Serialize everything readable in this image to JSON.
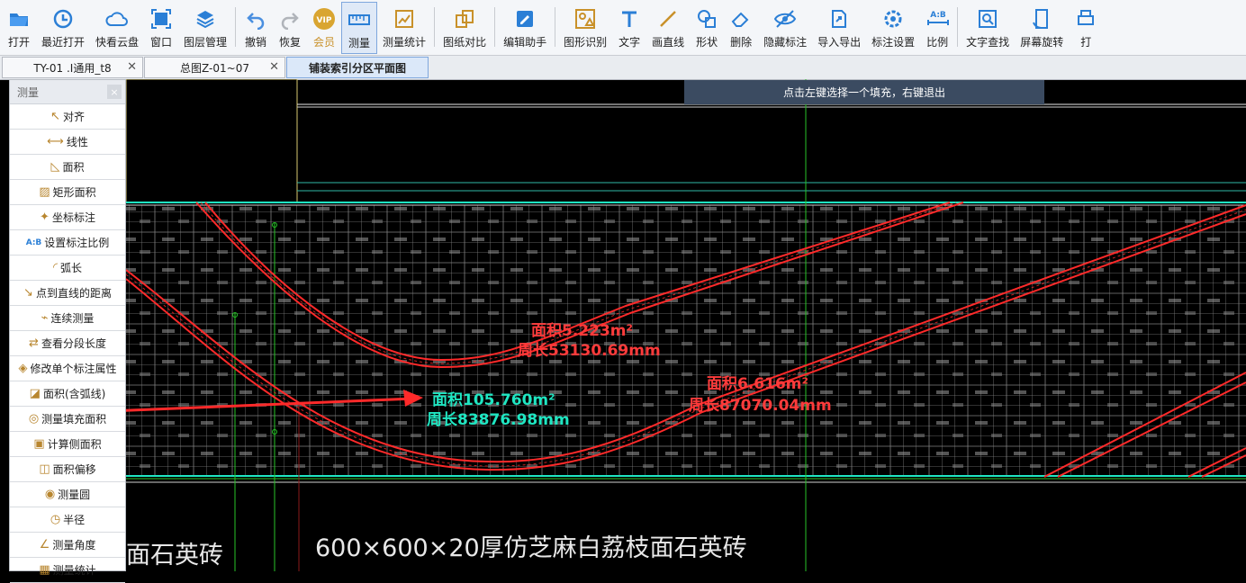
{
  "toolbar": {
    "items": [
      {
        "label": "打开",
        "icon": "open-folder-icon"
      },
      {
        "label": "最近打开",
        "icon": "recent-icon"
      },
      {
        "label": "快看云盘",
        "icon": "cloud-icon"
      },
      {
        "label": "窗口",
        "icon": "window-icon"
      },
      {
        "label": "图层管理",
        "icon": "layers-icon"
      },
      {
        "label": "撤销",
        "icon": "undo-icon"
      },
      {
        "label": "恢复",
        "icon": "redo-icon"
      },
      {
        "label": "会员",
        "icon": "vip-icon",
        "badge": "VIP"
      },
      {
        "label": "测量",
        "icon": "measure-icon"
      },
      {
        "label": "测量统计",
        "icon": "measure-stats-icon"
      },
      {
        "label": "图纸对比",
        "icon": "compare-icon"
      },
      {
        "label": "编辑助手",
        "icon": "edit-assistant-icon"
      },
      {
        "label": "图形识别",
        "icon": "shape-recognition-icon"
      },
      {
        "label": "文字",
        "icon": "text-icon"
      },
      {
        "label": "画直线",
        "icon": "line-icon"
      },
      {
        "label": "形状",
        "icon": "shape-icon"
      },
      {
        "label": "删除",
        "icon": "eraser-icon"
      },
      {
        "label": "隐藏标注",
        "icon": "hide-annotation-icon"
      },
      {
        "label": "导入导出",
        "icon": "import-export-icon"
      },
      {
        "label": "标注设置",
        "icon": "annotation-settings-icon"
      },
      {
        "label": "比例",
        "icon": "scale-icon",
        "badge": "A:B"
      },
      {
        "label": "文字查找",
        "icon": "text-search-icon"
      },
      {
        "label": "屏幕旋转",
        "icon": "rotate-screen-icon"
      },
      {
        "label": "打",
        "icon": "print-icon"
      }
    ],
    "active": "测量"
  },
  "tabs": [
    {
      "label": "TY-01 .I通用_t8"
    },
    {
      "label": "总图Z-01~07"
    },
    {
      "label": "铺装索引分区平面图"
    }
  ],
  "panel": {
    "title": "测量",
    "close": "×",
    "tools": [
      {
        "label": "对齐",
        "icon": "align-icon"
      },
      {
        "label": "线性",
        "icon": "linear-icon"
      },
      {
        "label": "面积",
        "icon": "area-icon"
      },
      {
        "label": "矩形面积",
        "icon": "rect-area-icon"
      },
      {
        "label": "坐标标注",
        "icon": "coordinate-icon"
      },
      {
        "label": "设置标注比例",
        "icon": "scale-setting-icon"
      },
      {
        "label": "弧长",
        "icon": "arc-length-icon"
      },
      {
        "label": "点到直线的距离",
        "icon": "point-line-icon"
      },
      {
        "label": "连续测量",
        "icon": "continuous-measure-icon"
      },
      {
        "label": "查看分段长度",
        "icon": "segment-length-icon"
      },
      {
        "label": "修改单个标注属性",
        "icon": "edit-annotation-icon"
      },
      {
        "label": "面积(含弧线)",
        "icon": "arc-area-icon"
      },
      {
        "label": "测量填充面积",
        "icon": "fill-area-icon"
      },
      {
        "label": "计算侧面积",
        "icon": "side-area-icon"
      },
      {
        "label": "面积偏移",
        "icon": "area-offset-icon"
      },
      {
        "label": "测量圆",
        "icon": "circle-measure-icon"
      },
      {
        "label": "半径",
        "icon": "radius-icon"
      },
      {
        "label": "测量角度",
        "icon": "angle-icon"
      },
      {
        "label": "测量统计",
        "icon": "stats-icon"
      }
    ]
  },
  "hint": "点击左键选择一个填充，右键退出",
  "drawing": {
    "annotations": [
      {
        "area": "面积5.223m²",
        "perimeter": "周长53130.69mm",
        "color": "#ff3b3b"
      },
      {
        "area": "面积105.760m²",
        "perimeter": "周长83876.98mm",
        "color": "#1fe6c2"
      },
      {
        "area": "面积6.616m²",
        "perimeter": "周长87070.04mm",
        "color": "#ff3b3b"
      }
    ],
    "caption": "600×600×20厚仿芝麻白荔枝面石英砖",
    "caption_partial": "面石英砖",
    "colors": {
      "outline": "#ff2a2a",
      "grid": "#8a8a8a",
      "guide": "#27c427",
      "highlight": "#1fe6c2"
    }
  }
}
